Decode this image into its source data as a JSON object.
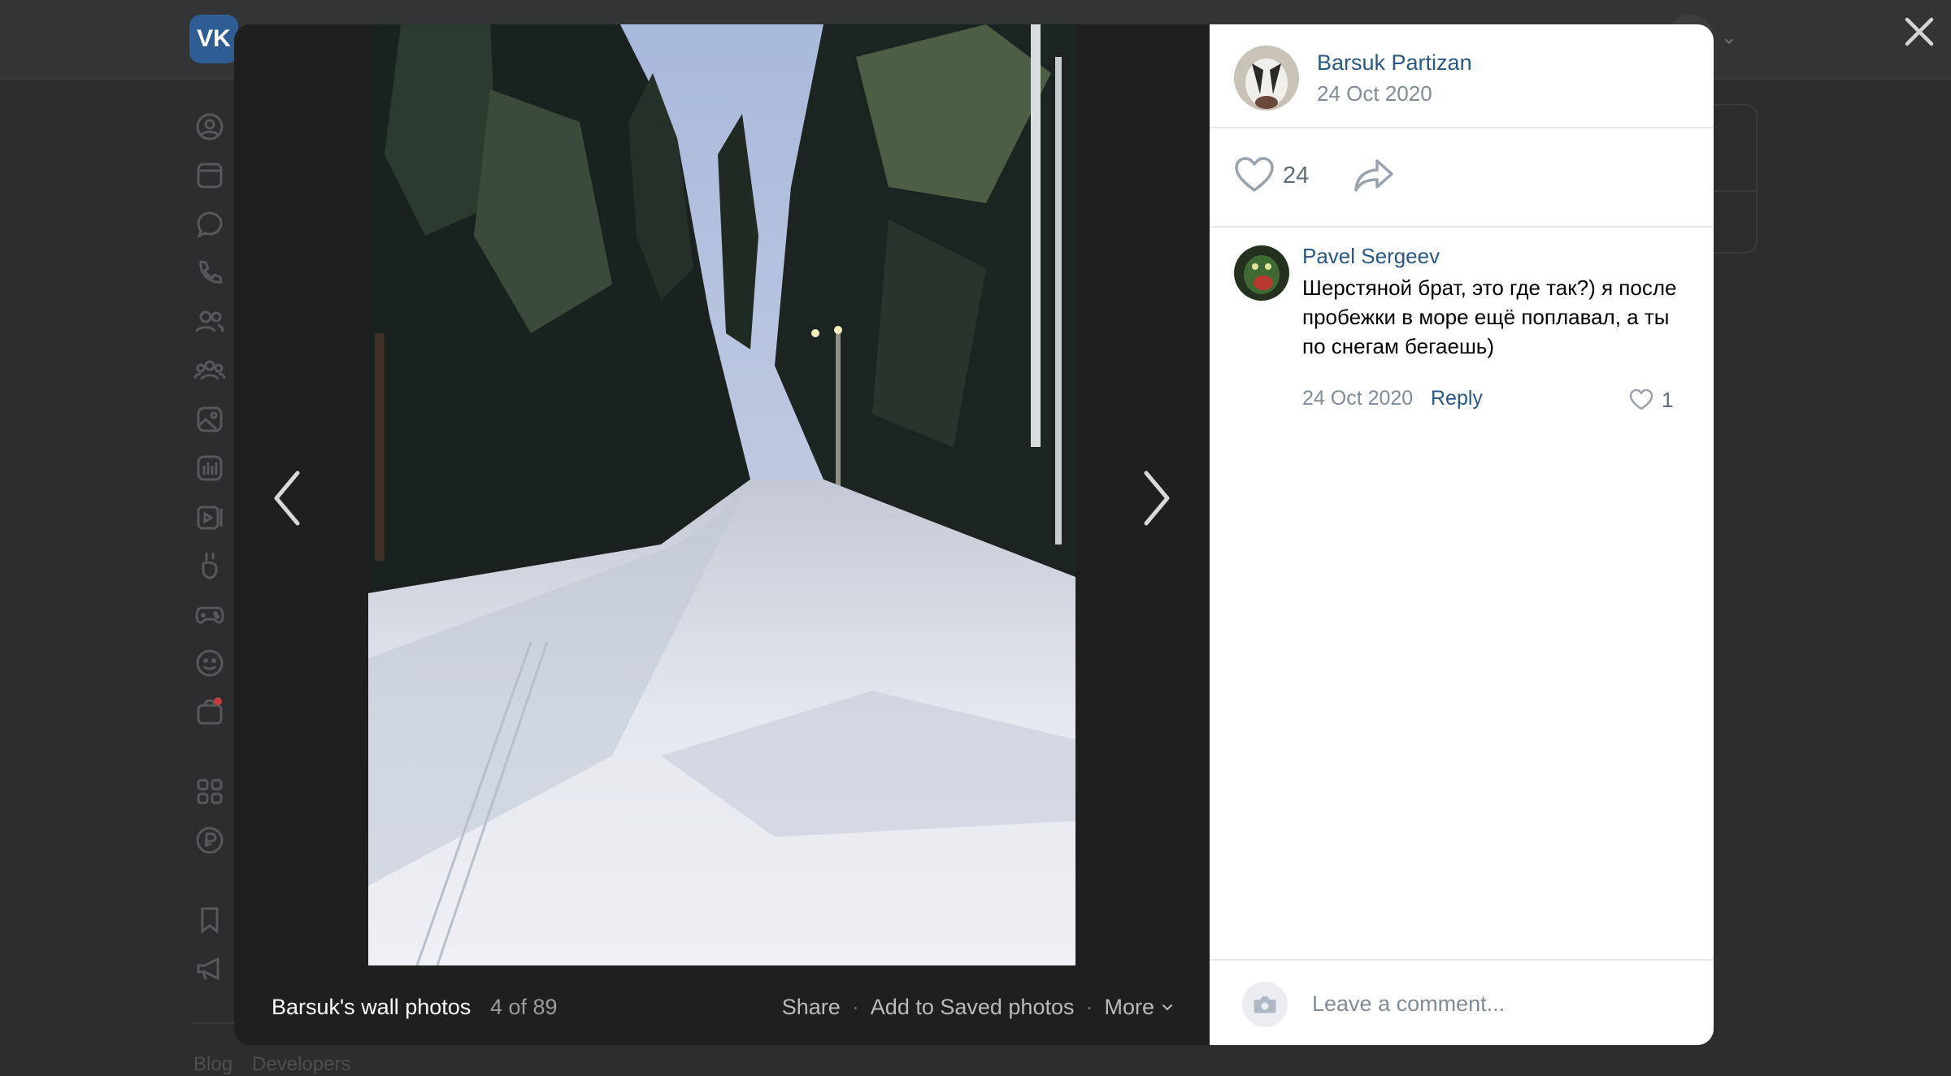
{
  "header": {
    "logo_text": "VK"
  },
  "sidebar": {
    "icons": [
      "profile-icon",
      "news-icon",
      "messenger-icon",
      "calls-icon",
      "friends-icon",
      "communities-icon",
      "photos-icon",
      "music-icon",
      "video-icon",
      "clips-icon",
      "games-icon",
      "stickers-icon",
      "market-icon",
      "services-icon",
      "vk-pay-icon",
      "bookmarks-icon",
      "ads-icon"
    ]
  },
  "footer": {
    "links": [
      "Blog",
      "Developers"
    ]
  },
  "viewer": {
    "album_title": "Barsuk's wall photos",
    "counter": "4 of 89",
    "actions": {
      "share": "Share",
      "save": "Add to Saved photos",
      "more": "More"
    },
    "separator": "·"
  },
  "post": {
    "author": "Barsuk Partizan",
    "date": "24 Oct 2020",
    "likes": "24"
  },
  "comments": [
    {
      "author": "Pavel Sergeev",
      "text": "Шерстяной брат, это где так?) я после пробежки в море ещё поплавал, а ты по снегам бегаешь)",
      "date": "24 Oct 2020",
      "reply_label": "Reply",
      "likes": "1"
    }
  ],
  "comment_box": {
    "placeholder": "Leave a comment..."
  },
  "colors": {
    "link": "#2a5885",
    "muted": "#818c99",
    "backdrop": "#2c2d2e",
    "viewer_bg": "#1f1f1f",
    "brand": "#2d5d93"
  }
}
